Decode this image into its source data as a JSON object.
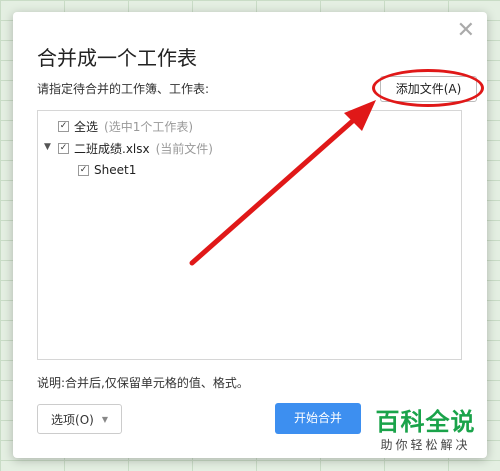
{
  "dialog": {
    "title": "合并成一个工作表",
    "close_glyph": "✕",
    "instruction": "请指定待合并的工作簿、工作表:",
    "add_file_button": "添加文件(A)",
    "tree": {
      "select_all_label": "全选",
      "select_all_note": "(选中1个工作表)",
      "file_label": "二班成绩.xlsx",
      "file_note": "(当前文件)",
      "sheet_label": "Sheet1",
      "check_glyph": "✓",
      "expand_glyph": "▼"
    },
    "footnote": "说明:合并后,仅保留单元格的值、格式。",
    "options_button": "选项(O)",
    "options_dropdown_glyph": "▼",
    "start_button": "开始合并"
  },
  "watermark": {
    "main": "百科全说",
    "sub": "助你轻松解决"
  },
  "colors": {
    "accent_blue": "#3d8ff0",
    "annotation_red": "#e01818",
    "watermark_green": "#1aa34a"
  }
}
